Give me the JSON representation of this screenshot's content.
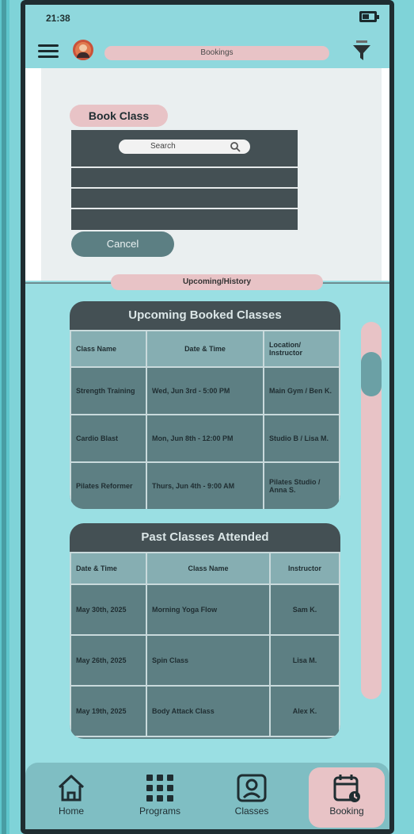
{
  "status_bar": {
    "time": "21:38"
  },
  "top_nav": {
    "title": "Bookings"
  },
  "booking_panel": {
    "title": "Book Class",
    "search_placeholder": "Search",
    "cancel_label": "Cancel"
  },
  "section_tab": {
    "label": "Upcoming/History"
  },
  "upcoming": {
    "title": "Upcoming Booked Classes",
    "headers": [
      "Class Name",
      "Date & Time",
      "Location/ Instructor"
    ],
    "rows": [
      [
        "Strength Training",
        "Wed, Jun 3rd - 5:00 PM",
        "Main Gym / Ben K."
      ],
      [
        "Cardio Blast",
        "Mon, Jun 8th - 12:00 PM",
        "Studio B / Lisa M."
      ],
      [
        "Pilates Reformer",
        "Thurs, Jun 4th - 9:00 AM",
        "Pilates Studio / Anna S."
      ]
    ]
  },
  "past": {
    "title": "Past Classes Attended",
    "headers": [
      "Date & Time",
      "Class Name",
      "Instructor"
    ],
    "rows": [
      [
        "May 30th, 2025",
        "Morning Yoga Flow",
        "Sam K."
      ],
      [
        "May 26th, 2025",
        "Spin Class",
        "Lisa M."
      ],
      [
        "May 19th, 2025",
        "Body Attack Class",
        "Alex K."
      ]
    ]
  },
  "bottom_nav": {
    "items": [
      {
        "label": "Home",
        "icon": "home-icon"
      },
      {
        "label": "Programs",
        "icon": "grid-icon"
      },
      {
        "label": "Classes",
        "icon": "class-icon"
      },
      {
        "label": "Booking",
        "icon": "calendar-icon",
        "active": true
      }
    ]
  },
  "colors": {
    "background": "#7fd3d8",
    "accent_pink": "#e8c3c6",
    "card_dark": "#445054",
    "card_mid": "#5d7f83"
  }
}
